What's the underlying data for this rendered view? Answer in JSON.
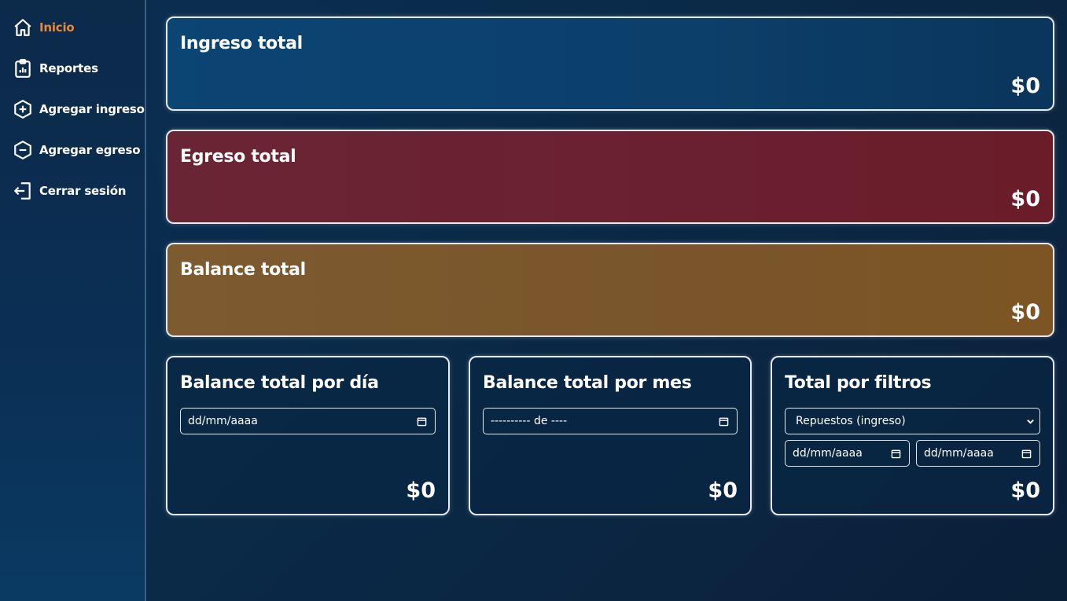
{
  "sidebar": {
    "items": [
      {
        "label": "Inicio",
        "icon": "home-icon",
        "active": true
      },
      {
        "label": "Reportes",
        "icon": "clipboard-chart-icon"
      },
      {
        "label": "Agregar ingreso",
        "icon": "hexagon-plus-icon"
      },
      {
        "label": "Agregar egreso",
        "icon": "hexagon-minus-icon"
      },
      {
        "label": "Cerrar sesión",
        "icon": "logout-icon"
      }
    ]
  },
  "cards": {
    "ingreso": {
      "title": "Ingreso total",
      "amount": "$0"
    },
    "egreso": {
      "title": "Egreso total",
      "amount": "$0"
    },
    "balance": {
      "title": "Balance total",
      "amount": "$0"
    }
  },
  "por_dia": {
    "title": "Balance total por día",
    "date_placeholder": "dd/mm/aaaa",
    "amount": "$0"
  },
  "por_mes": {
    "title": "Balance total por mes",
    "month_placeholder": "---------- de ----",
    "amount": "$0"
  },
  "filtros": {
    "title": "Total por filtros",
    "selected": "Repuestos (ingreso)",
    "date_from_placeholder": "dd/mm/aaaa",
    "date_to_placeholder": "dd/mm/aaaa",
    "amount": "$0"
  },
  "colors": {
    "active_nav": "#e8893a",
    "ingreso": "#0b4574",
    "egreso": "#6a2030",
    "balance": "#7d5a2f"
  }
}
